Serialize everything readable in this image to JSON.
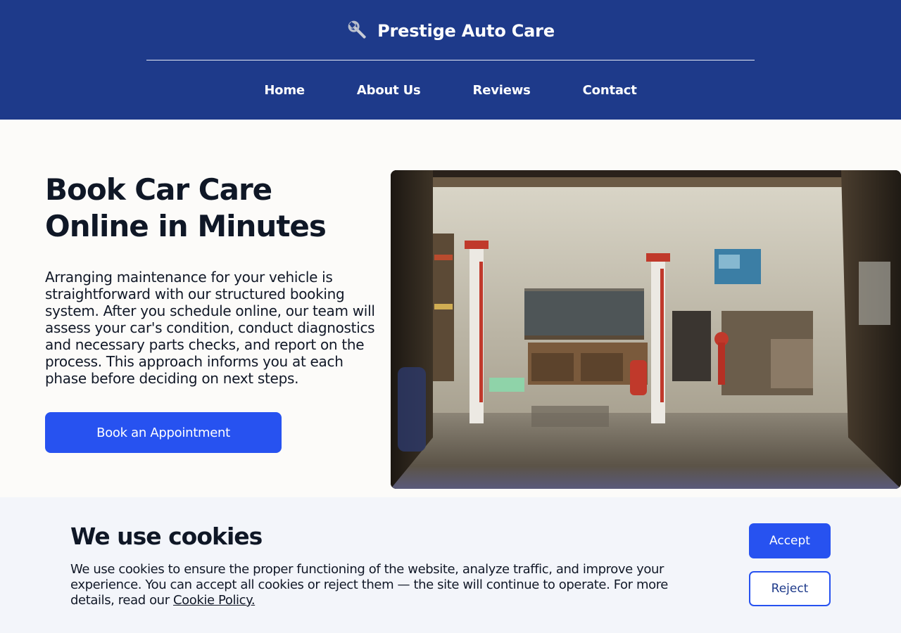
{
  "header": {
    "brand_icon": "wrench-icon",
    "brand_name": "Prestige Auto Care",
    "background_color": "#1e3a8a",
    "nav": [
      {
        "label": "Home"
      },
      {
        "label": "About Us"
      },
      {
        "label": "Reviews"
      },
      {
        "label": "Contact"
      }
    ]
  },
  "hero": {
    "title": "Book Car Care Online in Minutes",
    "description": "Arranging maintenance for your vehicle is straightforward with our structured booking system. After you schedule online, our team will assess your car's condition, conduct diagnostics and necessary parts checks, and report on the process. This approach informs you at each phase before deciding on next steps.",
    "cta_label": "Book an Appointment",
    "accent_color": "#2752f0"
  },
  "cookie_banner": {
    "title": "We use cookies",
    "text": "We use cookies to ensure the proper functioning of the website, analyze traffic, and improve your experience. You can accept all cookies or reject them — the site will continue to operate. For more details, read our ",
    "policy_link": "Cookie Policy.",
    "accept_label": "Accept",
    "reject_label": "Reject"
  }
}
